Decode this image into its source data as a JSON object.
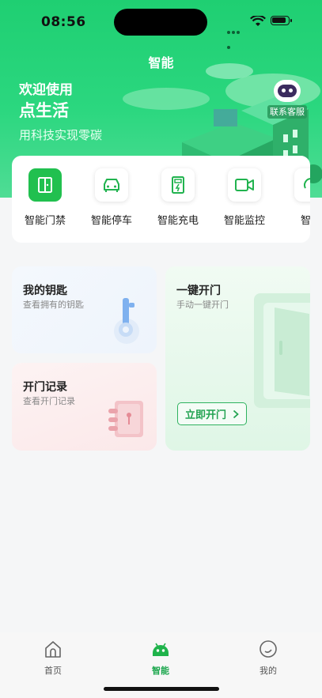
{
  "status_bar": {
    "time": "08:56"
  },
  "header": {
    "title": "智能"
  },
  "banner": {
    "welcome": "欢迎使用",
    "brand": "点生活",
    "slogan": "用科技实现零碳",
    "support_label": "联系客服"
  },
  "services": [
    {
      "label": "智能门禁",
      "icon": "door-icon",
      "active": true
    },
    {
      "label": "智能停车",
      "icon": "car-icon",
      "active": false
    },
    {
      "label": "智能充电",
      "icon": "charging-icon",
      "active": false
    },
    {
      "label": "智能监控",
      "icon": "camera-icon",
      "active": false
    },
    {
      "label": "智能",
      "icon": "more-icon",
      "active": false
    }
  ],
  "cards": {
    "keys": {
      "title": "我的钥匙",
      "subtitle": "查看拥有的钥匙"
    },
    "records": {
      "title": "开门记录",
      "subtitle": "查看开门记录"
    },
    "one_key": {
      "title": "一键开门",
      "subtitle": "手动一键开门",
      "button": "立即开门"
    }
  },
  "tabbar": [
    {
      "label": "首页",
      "icon": "home-icon",
      "active": false
    },
    {
      "label": "智能",
      "icon": "robot-icon",
      "active": true
    },
    {
      "label": "我的",
      "icon": "profile-icon",
      "active": false
    }
  ],
  "colors": {
    "brand_green": "#21c04f",
    "hero_green": "#1fcf72",
    "active_tab": "#1aa64c"
  }
}
